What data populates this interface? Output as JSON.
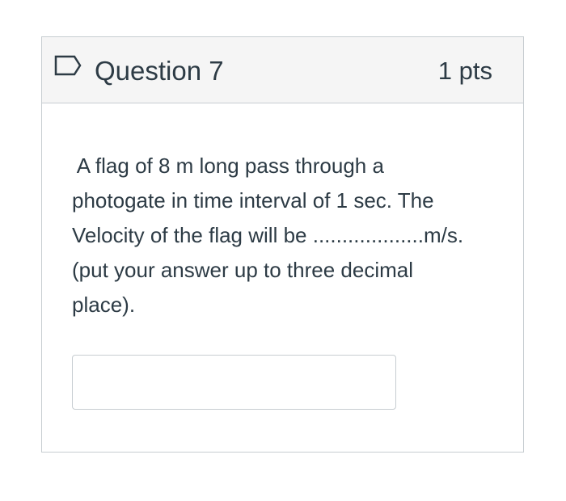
{
  "question": {
    "title": "Question 7",
    "points": "1 pts",
    "flag_icon": "flag-outline-icon",
    "text_lines": [
      " A flag of 8 m long pass through a",
      "photogate in time interval of 1 sec. The",
      "Velocity of the flag will be ...................m/s.",
      "(put your answer up to three decimal",
      "place)."
    ],
    "answer": {
      "value": "",
      "placeholder": ""
    }
  },
  "colors": {
    "header_bg": "#f5f5f5",
    "border": "#c7cdd1",
    "text": "#2d3b45",
    "flag_stroke": "#2d3b45"
  }
}
